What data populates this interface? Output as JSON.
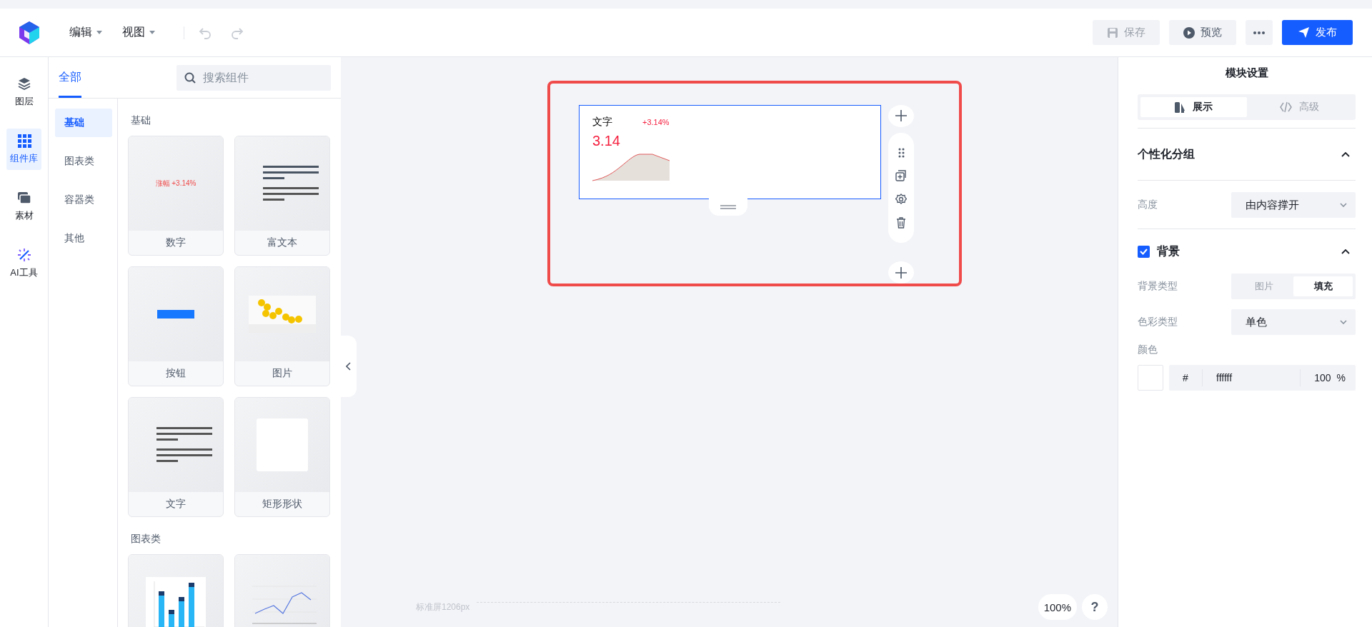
{
  "header": {
    "menus": [
      {
        "label": "编辑"
      },
      {
        "label": "视图"
      }
    ],
    "buttons": [
      {
        "kind": "save",
        "label": "保存",
        "disabled": true
      },
      {
        "kind": "preview",
        "label": "预览",
        "disabled": false
      },
      {
        "kind": "more",
        "disabled": false
      },
      {
        "kind": "publish",
        "label": "发布",
        "disabled": false
      }
    ]
  },
  "rail": [
    {
      "kind": "layers",
      "label": "图层",
      "selected": false
    },
    {
      "kind": "grid",
      "label": "组件库",
      "selected": true
    },
    {
      "kind": "cards",
      "label": "素材",
      "selected": false
    },
    {
      "kind": "ai",
      "label": "AI工具",
      "selected": false
    }
  ],
  "panel": {
    "tabs": [
      {
        "label": "全部",
        "selected": true
      }
    ],
    "search": {
      "placeholder": "搜索组件"
    },
    "categories": [
      {
        "label": "基础",
        "selected": true
      },
      {
        "label": "图表类",
        "selected": false
      },
      {
        "label": "容器类",
        "selected": false
      },
      {
        "label": "其他",
        "selected": false
      }
    ],
    "sections": [
      {
        "title": "基础",
        "items": [
          {
            "label": "数字",
            "kind": "number",
            "preview_text": "涨幅  +3.14%"
          },
          {
            "label": "富文本",
            "kind": "richtext"
          },
          {
            "label": "按钮",
            "kind": "button"
          },
          {
            "label": "图片"
          },
          {
            "label": "文字",
            "kind": "text"
          },
          {
            "label": "矩形形状",
            "kind": "rect"
          }
        ]
      },
      {
        "title": "图表类",
        "items": [
          {
            "kind": "bar"
          },
          {
            "kind": "line"
          }
        ]
      }
    ]
  },
  "canvas": {
    "module": {
      "title": "文字",
      "change": "+3.14%",
      "value": "3.14"
    },
    "screen_label": "标准屏1206px",
    "zoom": "100%",
    "help": "?"
  },
  "settings": {
    "title": "模块设置",
    "tabs": [
      {
        "kind": "display",
        "label": "展示",
        "selected": true
      },
      {
        "kind": "code",
        "label": "高级",
        "selected": false
      }
    ],
    "group": {
      "title": "个性化分组",
      "expanded": true
    },
    "height": {
      "label": "高度",
      "value": "由内容撑开"
    },
    "background": {
      "label": "背景",
      "checked": true,
      "expanded": true
    },
    "bg_type": {
      "label": "背景类型",
      "options": [
        {
          "label": "图片",
          "selected": false
        },
        {
          "label": "填充",
          "selected": true
        }
      ]
    },
    "color_type": {
      "label": "色彩类型",
      "value": "单色"
    },
    "color": {
      "label": "颜色",
      "hash": "#",
      "hex": "ffffff",
      "opacity": "100",
      "unit": "%"
    }
  }
}
